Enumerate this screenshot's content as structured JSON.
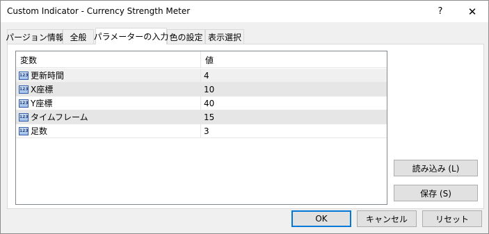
{
  "window": {
    "title": "Custom Indicator - Currency Strength Meter",
    "help_label": "?",
    "close_label": "✕"
  },
  "tabs": [
    {
      "label": "パージョン情報",
      "active": false
    },
    {
      "label": "全般",
      "active": false
    },
    {
      "label": "パラメーターの入力",
      "active": true
    },
    {
      "label": "色の設定",
      "active": false
    },
    {
      "label": "表示選択",
      "active": false
    }
  ],
  "params_table": {
    "headers": [
      "変数",
      "値"
    ],
    "rows": [
      {
        "icon": "123-icon",
        "icon_text": "123",
        "name": "更新時間",
        "value": "4"
      },
      {
        "icon": "123-icon",
        "icon_text": "123",
        "name": "X座標",
        "value": "10"
      },
      {
        "icon": "123-icon",
        "icon_text": "123",
        "name": "Y座標",
        "value": "40"
      },
      {
        "icon": "123-icon",
        "icon_text": "123",
        "name": "タイムフレーム",
        "value": "15"
      },
      {
        "icon": "123-icon",
        "icon_text": "123",
        "name": "足数",
        "value": "3"
      }
    ]
  },
  "side_buttons": {
    "load_label": "読み込み (L)",
    "save_label": "保存 (S)"
  },
  "footer_buttons": {
    "ok_label": "OK",
    "cancel_label": "キャンセル",
    "reset_label": "リセット"
  }
}
